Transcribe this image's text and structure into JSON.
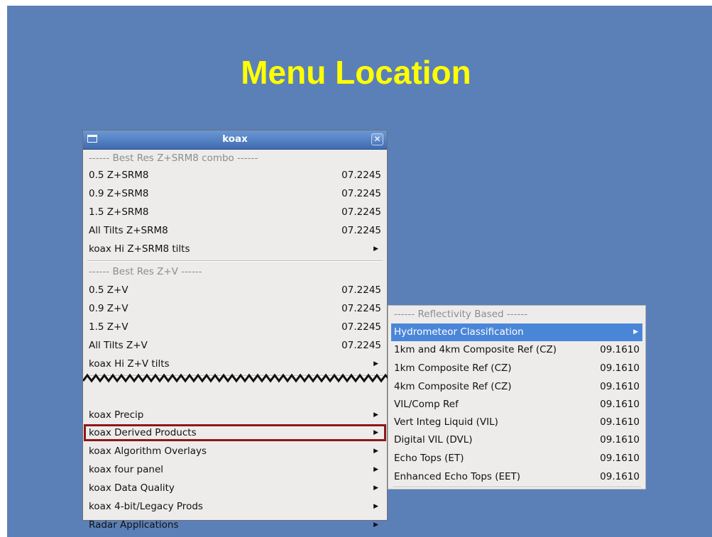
{
  "slide": {
    "title": "Menu Location"
  },
  "window": {
    "title": "koax",
    "close_glyph": "✕"
  },
  "menu": {
    "group1": {
      "header": "------ Best Res Z+SRM8 combo ------",
      "items": [
        {
          "label": "0.5 Z+SRM8",
          "value": "07.2245"
        },
        {
          "label": "0.9 Z+SRM8",
          "value": "07.2245"
        },
        {
          "label": "1.5 Z+SRM8",
          "value": "07.2245"
        },
        {
          "label": "All Tilts Z+SRM8",
          "value": "07.2245"
        },
        {
          "label": "koax Hi Z+SRM8 tilts",
          "arrow": "▶"
        }
      ]
    },
    "group2": {
      "header": "------ Best Res Z+V ------",
      "items": [
        {
          "label": "0.5 Z+V",
          "value": "07.2245"
        },
        {
          "label": "0.9 Z+V",
          "value": "07.2245"
        },
        {
          "label": "1.5 Z+V",
          "value": "07.2245"
        },
        {
          "label": "All Tilts Z+V",
          "value": "07.2245"
        },
        {
          "label": "koax Hi Z+V tilts",
          "arrow": "▶"
        }
      ]
    },
    "group3": {
      "items": [
        {
          "label": "koax Precip",
          "arrow": "▶"
        },
        {
          "label": "koax Derived Products",
          "arrow": "▶"
        },
        {
          "label": "koax Algorithm Overlays",
          "arrow": "▶"
        },
        {
          "label": "koax four panel",
          "arrow": "▶"
        },
        {
          "label": "koax Data Quality",
          "arrow": "▶"
        },
        {
          "label": "koax 4-bit/Legacy Prods",
          "arrow": "▶"
        },
        {
          "label": "Radar Applications",
          "arrow": "▶"
        }
      ]
    }
  },
  "submenu": {
    "header": "------ Reflectivity Based ------",
    "items": [
      {
        "label": "Hydrometeor Classification",
        "arrow": "▶"
      },
      {
        "label": "1km and 4km Composite Ref (CZ)",
        "value": "09.1610"
      },
      {
        "label": "1km Composite Ref (CZ)",
        "value": "09.1610"
      },
      {
        "label": "4km Composite Ref (CZ)",
        "value": "09.1610"
      },
      {
        "label": "VIL/Comp Ref",
        "value": "09.1610"
      },
      {
        "label": "Vert Integ Liquid (VIL)",
        "value": "09.1610"
      },
      {
        "label": "Digital VIL (DVL)",
        "value": "09.1610"
      },
      {
        "label": "Echo Tops (ET)",
        "value": "09.1610"
      },
      {
        "label": "Enhanced Echo Tops (EET)",
        "value": "09.1610"
      }
    ]
  },
  "colors": {
    "slide_background": "#5b80b8",
    "title_text": "#ffff00",
    "menu_background": "#edeceb",
    "selection": "#4a86d8",
    "highlight_box": "#8c1818"
  }
}
